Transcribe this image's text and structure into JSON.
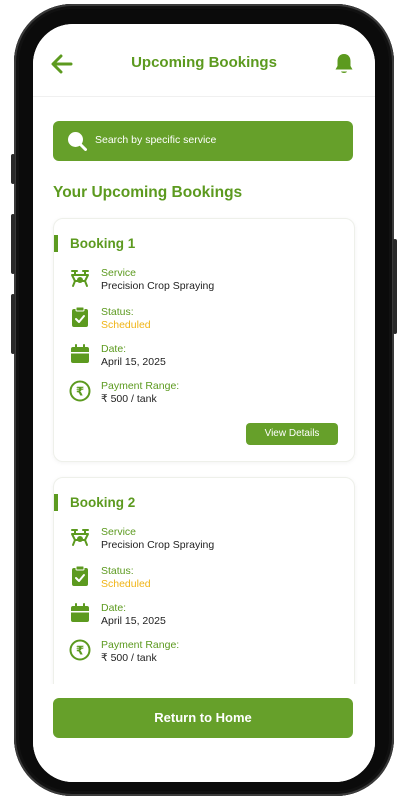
{
  "header": {
    "title": "Upcoming Bookings"
  },
  "search": {
    "placeholder": "Search by specific service"
  },
  "section": {
    "title": "Your Upcoming Bookings"
  },
  "bookings": [
    {
      "title": "Booking 1",
      "service_label": "Service",
      "service_value": "Precision Crop Spraying",
      "status_label": "Status:",
      "status_value": "Scheduled",
      "date_label": "Date:",
      "date_value": "April 15, 2025",
      "payment_label": "Payment Range:",
      "payment_value": "₹ 500 / tank",
      "button_label": "View Details"
    },
    {
      "title": "Booking 2",
      "service_label": "Service",
      "service_value": "Precision Crop Spraying",
      "status_label": "Status:",
      "status_value": "Scheduled",
      "date_label": "Date:",
      "date_value": "April 15, 2025",
      "payment_label": "Payment Range:",
      "payment_value": "₹ 500 / tank"
    }
  ],
  "footer": {
    "return_label": "Return to Home"
  },
  "colors": {
    "brand": "#66a02a",
    "brand_text": "#5c9a1f",
    "status": "#f0b416"
  }
}
